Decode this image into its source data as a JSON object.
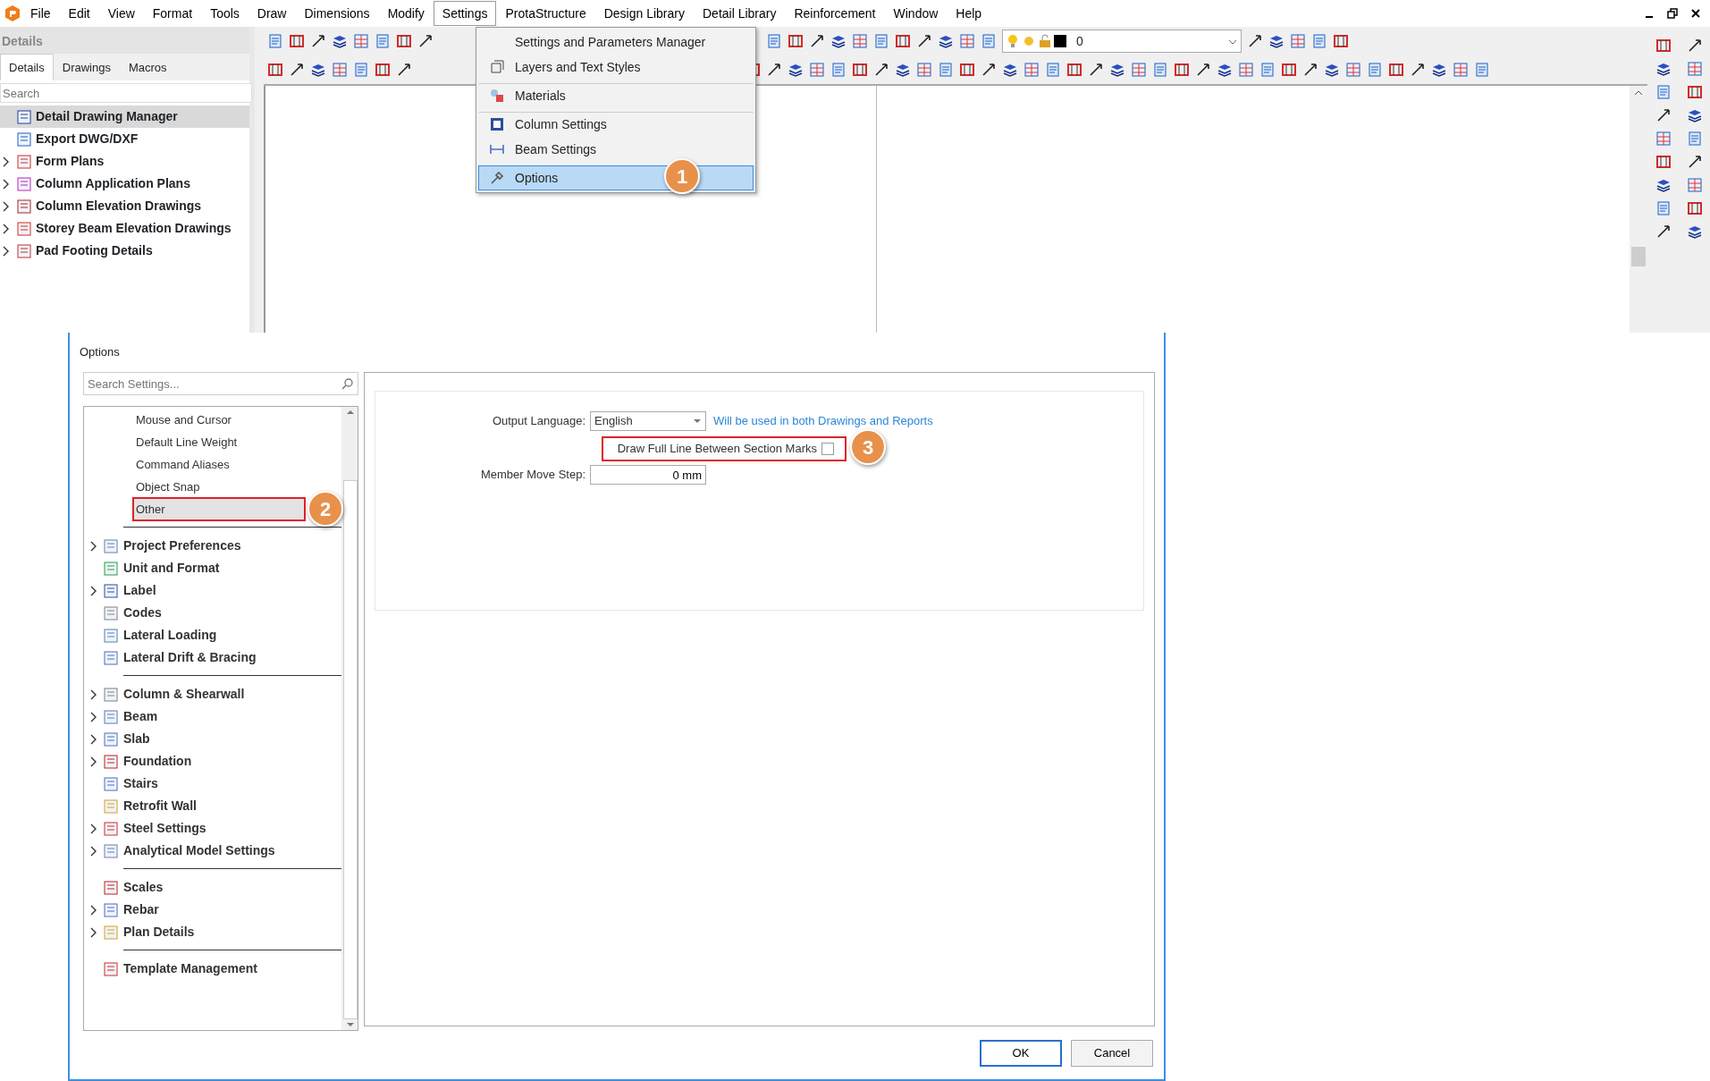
{
  "menu_bar": {
    "items": [
      {
        "label": "File",
        "selected": false
      },
      {
        "label": "Edit",
        "selected": false
      },
      {
        "label": "View",
        "selected": false
      },
      {
        "label": "Format",
        "selected": false
      },
      {
        "label": "Tools",
        "selected": false
      },
      {
        "label": "Draw",
        "selected": false
      },
      {
        "label": "Dimensions",
        "selected": false
      },
      {
        "label": "Modify",
        "selected": false
      },
      {
        "label": "Settings",
        "selected": true
      },
      {
        "label": "ProtaStructure",
        "selected": false
      },
      {
        "label": "Design Library",
        "selected": false
      },
      {
        "label": "Detail Library",
        "selected": false
      },
      {
        "label": "Reinforcement",
        "selected": false
      },
      {
        "label": "Window",
        "selected": false
      },
      {
        "label": "Help",
        "selected": false
      }
    ]
  },
  "details_panel": {
    "title": "Details",
    "tabs": [
      {
        "label": "Details",
        "selected": true
      },
      {
        "label": "Drawings",
        "selected": false
      },
      {
        "label": "Macros",
        "selected": false
      }
    ],
    "search": {
      "placeholder": "Search"
    },
    "items": [
      {
        "label": "Detail Drawing Manager",
        "expandable": false,
        "selected": true
      },
      {
        "label": "Export DWG/DXF",
        "expandable": false,
        "selected": false
      },
      {
        "label": "Form Plans",
        "expandable": true,
        "selected": false
      },
      {
        "label": "Column Application Plans",
        "expandable": true,
        "selected": false
      },
      {
        "label": "Column Elevation Drawings",
        "expandable": true,
        "selected": false
      },
      {
        "label": "Storey Beam Elevation Drawings",
        "expandable": true,
        "selected": false
      },
      {
        "label": "Pad Footing Details",
        "expandable": true,
        "selected": false
      }
    ]
  },
  "layer_combo": {
    "value": "0"
  },
  "settings_menu": [
    {
      "label": "Settings and Parameters Manager",
      "divider_before": false,
      "selected": false
    },
    {
      "label": "Layers and Text Styles",
      "divider_before": false,
      "selected": false
    },
    {
      "label": "Materials",
      "divider_before": true,
      "selected": false
    },
    {
      "label": "Column Settings",
      "divider_before": true,
      "selected": false
    },
    {
      "label": "Beam Settings",
      "divider_before": false,
      "selected": false
    },
    {
      "label": "Options",
      "divider_before": true,
      "selected": true,
      "callout": "1"
    }
  ],
  "options_dialog": {
    "title": "Options",
    "search": {
      "placeholder": "Search Settings..."
    },
    "tree": [
      {
        "items": [
          {
            "label": "Mouse and Cursor",
            "kind": "sub",
            "expandable": false,
            "selected": false,
            "highlighted": false
          },
          {
            "label": "Default Line Weight",
            "kind": "sub",
            "expandable": false,
            "selected": false,
            "highlighted": false
          },
          {
            "label": "Command Aliases",
            "kind": "sub",
            "expandable": false,
            "selected": false,
            "highlighted": false
          },
          {
            "label": "Object Snap",
            "kind": "sub",
            "expandable": false,
            "selected": false,
            "highlighted": false
          },
          {
            "label": "Other",
            "kind": "sub",
            "expandable": false,
            "selected": true,
            "highlighted": true,
            "callout": "2"
          }
        ]
      },
      {
        "items": [
          {
            "label": "Project Preferences",
            "kind": "main",
            "expandable": true,
            "selected": false,
            "highlighted": false
          },
          {
            "label": "Unit and Format",
            "kind": "main",
            "expandable": false,
            "selected": false,
            "highlighted": false
          },
          {
            "label": "Label",
            "kind": "main",
            "expandable": true,
            "selected": false,
            "highlighted": false
          },
          {
            "label": "Codes",
            "kind": "main",
            "expandable": false,
            "selected": false,
            "highlighted": false
          },
          {
            "label": "Lateral Loading",
            "kind": "main",
            "expandable": false,
            "selected": false,
            "highlighted": false
          },
          {
            "label": "Lateral Drift & Bracing",
            "kind": "main",
            "expandable": false,
            "selected": false,
            "highlighted": false
          }
        ]
      },
      {
        "items": [
          {
            "label": "Column & Shearwall",
            "kind": "main",
            "expandable": true,
            "selected": false,
            "highlighted": false
          },
          {
            "label": "Beam",
            "kind": "main",
            "expandable": true,
            "selected": false,
            "highlighted": false
          },
          {
            "label": "Slab",
            "kind": "main",
            "expandable": true,
            "selected": false,
            "highlighted": false
          },
          {
            "label": "Foundation",
            "kind": "main",
            "expandable": true,
            "selected": false,
            "highlighted": false
          },
          {
            "label": "Stairs",
            "kind": "main",
            "expandable": false,
            "selected": false,
            "highlighted": false
          },
          {
            "label": "Retrofit Wall",
            "kind": "main",
            "expandable": false,
            "selected": false,
            "highlighted": false
          },
          {
            "label": "Steel Settings",
            "kind": "main",
            "expandable": true,
            "selected": false,
            "highlighted": false
          },
          {
            "label": "Analytical Model Settings",
            "kind": "main",
            "expandable": true,
            "selected": false,
            "highlighted": false
          }
        ]
      },
      {
        "items": [
          {
            "label": "Scales",
            "kind": "main",
            "expandable": false,
            "selected": false,
            "highlighted": false
          },
          {
            "label": "Rebar",
            "kind": "main",
            "expandable": true,
            "selected": false,
            "highlighted": false
          },
          {
            "label": "Plan Details",
            "kind": "main",
            "expandable": true,
            "selected": false,
            "highlighted": false
          }
        ]
      },
      {
        "items": [
          {
            "label": "Template Management",
            "kind": "main",
            "expandable": false,
            "selected": false,
            "highlighted": false
          }
        ]
      }
    ],
    "form": [
      {
        "kind": "select",
        "label": "Output Language:",
        "value": "English",
        "hint": "Will be used in both Drawings and Reports"
      },
      {
        "kind": "checkbox",
        "label": "Draw Full Line Between Section Marks",
        "checked": false,
        "highlighted": true,
        "callout": "3"
      },
      {
        "kind": "input",
        "label": "Member Move Step:",
        "value": "0 mm"
      }
    ],
    "buttons": [
      {
        "label": "OK",
        "selected": true
      },
      {
        "label": "Cancel",
        "selected": false
      }
    ]
  }
}
